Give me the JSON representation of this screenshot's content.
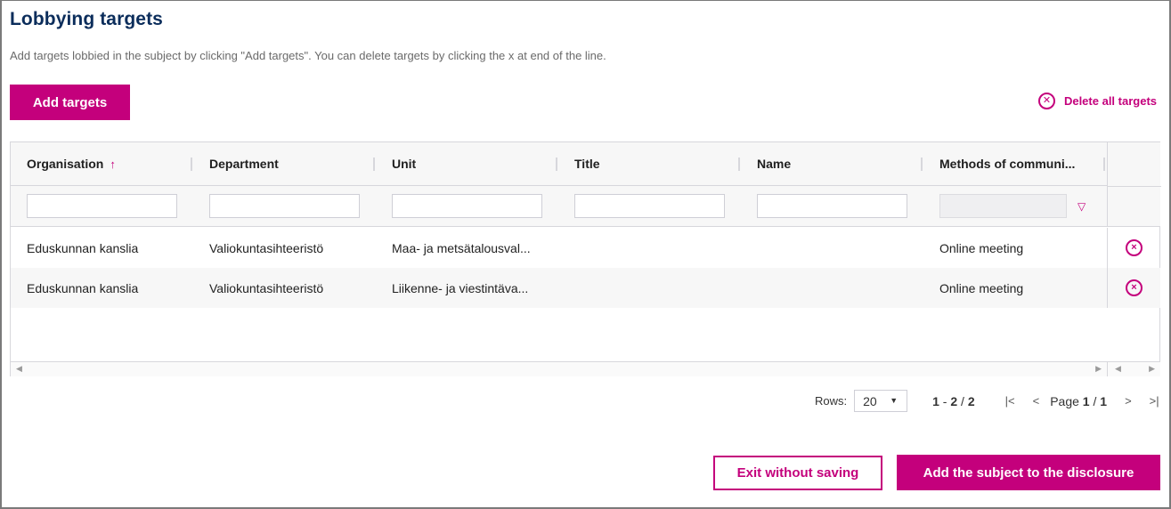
{
  "page": {
    "title": "Lobbying targets",
    "description": "Add targets lobbied in the subject by clicking \"Add targets\". You can delete targets by clicking the x at end of the line."
  },
  "toolbar": {
    "add_targets_label": "Add targets",
    "delete_all_label": "Delete all targets",
    "delete_all_icon": "circle-x-icon"
  },
  "colors": {
    "accent": "#c4007c",
    "title": "#0b2d5b"
  },
  "table": {
    "columns": [
      {
        "label": "Organisation",
        "sorted": "ascending"
      },
      {
        "label": "Department"
      },
      {
        "label": "Unit"
      },
      {
        "label": "Title"
      },
      {
        "label": "Name"
      },
      {
        "label": "Methods of communi..."
      }
    ],
    "filters": [
      "",
      "",
      "",
      "",
      "",
      ""
    ],
    "rows": [
      {
        "organisation": "Eduskunnan kanslia",
        "department": "Valiokuntasihteeristö",
        "unit": "Maa- ja metsätalousval...",
        "title": "",
        "name": "",
        "methods": "Online meeting"
      },
      {
        "organisation": "Eduskunnan kanslia",
        "department": "Valiokuntasihteeristö",
        "unit": "Liikenne- ja viestintäva...",
        "title": "",
        "name": "",
        "methods": "Online meeting"
      }
    ],
    "sort_icon": "↑",
    "filter_icon": "▽",
    "row_delete_icon": "×"
  },
  "pager": {
    "rows_label": "Rows:",
    "rows_value": "20",
    "range_start": "1",
    "range_end": "2",
    "total": "2",
    "page_label": "Page",
    "page_current": "1",
    "page_total": "1",
    "first_icon": "|<",
    "prev_icon": "<",
    "next_icon": ">",
    "last_icon": ">|"
  },
  "footer": {
    "exit_label": "Exit without saving",
    "submit_label": "Add the subject to the disclosure"
  }
}
